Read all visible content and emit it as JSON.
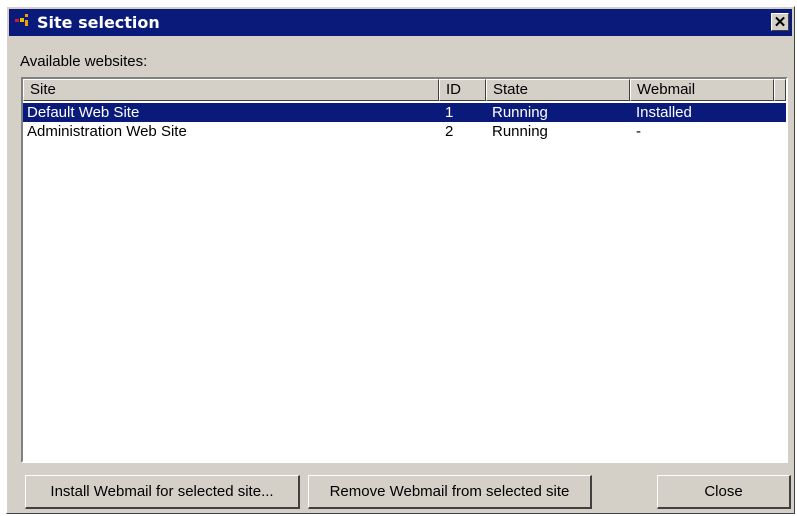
{
  "window": {
    "title": "Site selection",
    "close_glyph": "✕"
  },
  "list_label": "Available websites:",
  "table": {
    "columns": [
      "Site",
      "ID",
      "State",
      "Webmail"
    ],
    "rows": [
      {
        "site": "Default Web Site",
        "id": "1",
        "state": "Running",
        "webmail": "Installed",
        "selected": true
      },
      {
        "site": "Administration Web Site",
        "id": "2",
        "state": "Running",
        "webmail": "-",
        "selected": false
      }
    ]
  },
  "buttons": {
    "install": "Install Webmail for selected site...",
    "remove": "Remove Webmail from selected site",
    "close": "Close"
  },
  "colors": {
    "titlebar": "#0a1a7a",
    "selection": "#0a1a7a",
    "face": "#d4d0c8"
  }
}
